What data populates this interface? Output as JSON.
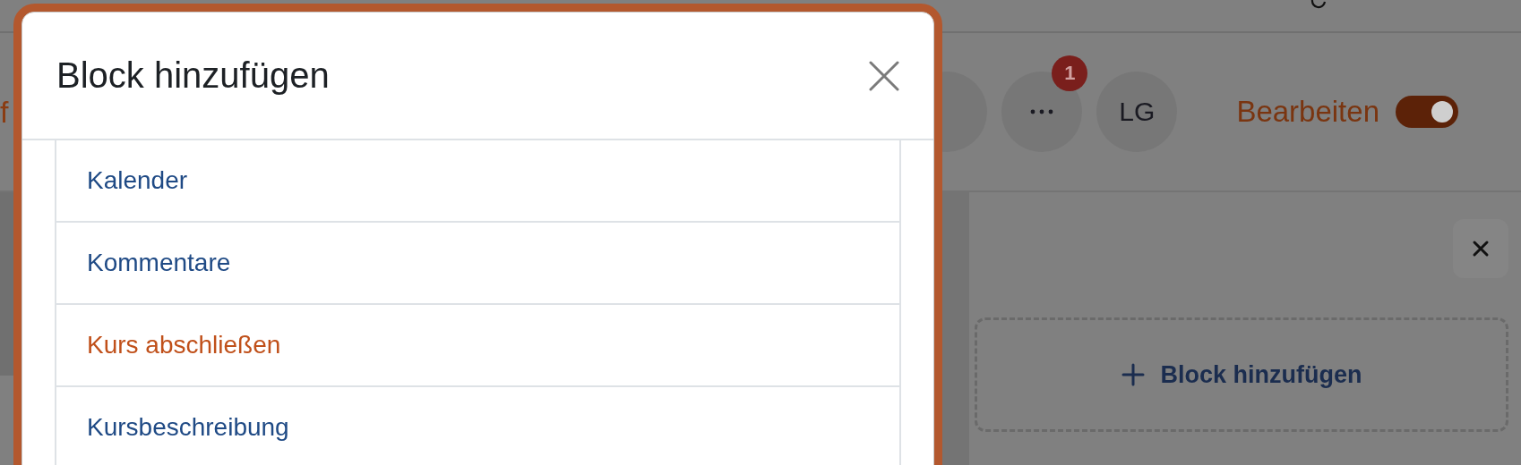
{
  "page": {
    "header": {
      "partial_link": "f",
      "more_button": {
        "badge": "1"
      },
      "avatar": "LG",
      "edit_mode": {
        "label": "Bearbeiten",
        "on": true
      }
    },
    "block_drawer": {
      "add_block_button": "Block hinzufügen"
    }
  },
  "modal": {
    "title": "Block hinzufügen",
    "items": [
      {
        "label": "Kalender",
        "selected": false
      },
      {
        "label": "Kommentare",
        "selected": false
      },
      {
        "label": "Kurs abschließen",
        "selected": true
      },
      {
        "label": "Kursbeschreibung",
        "selected": false
      }
    ]
  }
}
